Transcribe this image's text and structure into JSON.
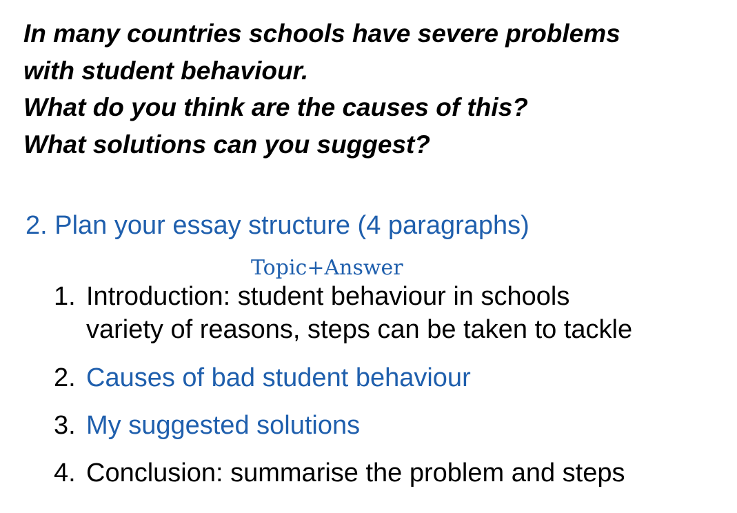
{
  "question": {
    "lines": [
      "In many countries schools have severe problems",
      "with student behaviour.",
      "What do you think are the causes of this?",
      "What solutions can you suggest?"
    ]
  },
  "plan": {
    "heading": "2. Plan your essay structure (4 paragraphs)",
    "annotation": "Topic+Answer",
    "items": [
      {
        "number": "1.",
        "lines": [
          "Introduction: student behaviour in schools",
          "variety of reasons, steps can be taken to tackle"
        ]
      },
      {
        "number": "2.",
        "lines": [
          "Causes of bad student behaviour"
        ]
      },
      {
        "number": "3.",
        "lines": [
          "My suggested solutions"
        ]
      },
      {
        "number": "4.",
        "lines": [
          "Conclusion: summarise the problem and steps"
        ]
      }
    ],
    "colors": {
      "accent_blue": "#1f5fad",
      "text_black": "#000000"
    }
  }
}
